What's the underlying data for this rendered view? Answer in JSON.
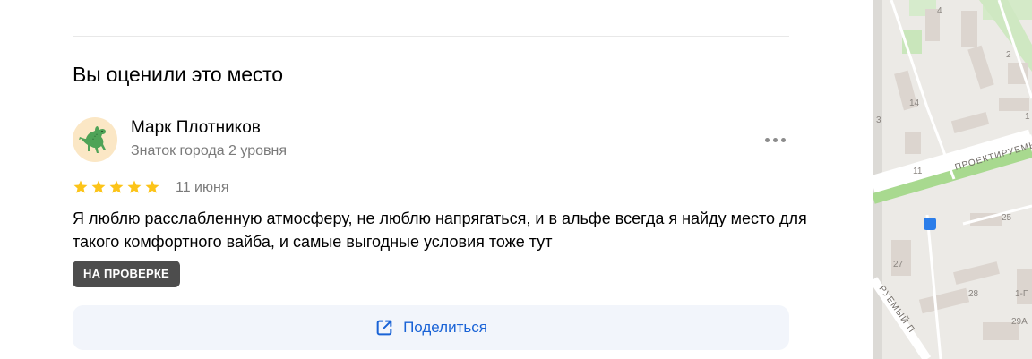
{
  "section": {
    "title": "Вы оценили это место"
  },
  "review": {
    "author_name": "Марк Плотников",
    "author_level": "Знаток города 2 уровня",
    "rating": 5,
    "date": "11 июня",
    "text": "Я люблю расслабленную атмосферу, не люблю напрягаться, и в альфе всегда я найду место для такого комфортного вайба, и самые выгодные условия тоже тут",
    "status": "НА ПРОВЕРКЕ"
  },
  "share": {
    "label": "Поделиться",
    "color": "#1a63d6"
  },
  "colors": {
    "star": "#fcc419",
    "badge_bg": "#4d4d4d",
    "share_bg": "#f2f5fb"
  },
  "icons": {
    "avatar": "dinosaur-icon",
    "more": "more-dots-icon",
    "share": "share-icon",
    "star": "star-icon"
  },
  "map": {
    "street_label_1": "ПРОЕКТИРУЕМЫ",
    "street_label_2": "РУЕМЫЙ П",
    "house_numbers": [
      "4",
      "2",
      "14",
      "3",
      "1",
      "11",
      "25",
      "27",
      "28",
      "1-Г",
      "29А"
    ]
  }
}
